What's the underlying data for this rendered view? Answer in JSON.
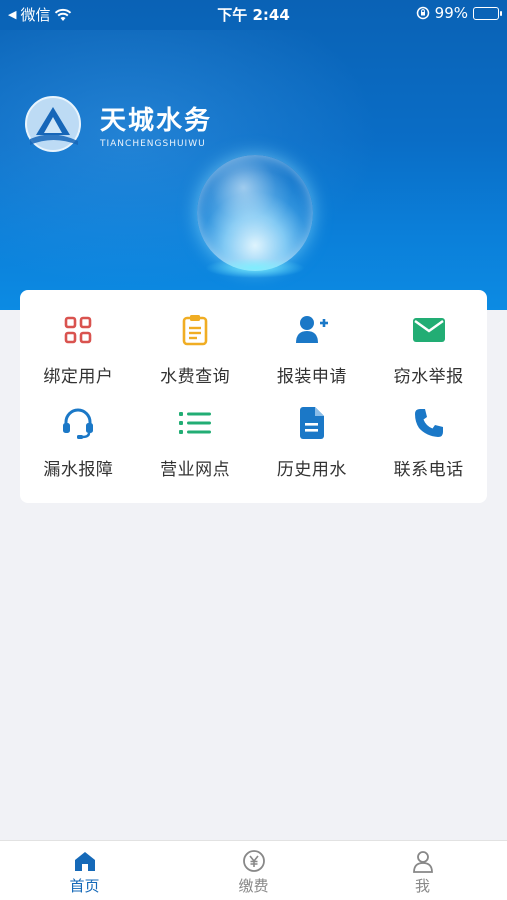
{
  "status_bar": {
    "back_app": "微信",
    "time": "下午 2:44",
    "battery": "99%",
    "battery_level": 0.99
  },
  "brand": {
    "title": "天城水务",
    "subtitle": "TIANCHENGSHUIWU"
  },
  "menu": [
    {
      "label": "绑定用户",
      "icon": "grid-icon",
      "color": "#d9534f"
    },
    {
      "label": "水费查询",
      "icon": "clipboard-icon",
      "color": "#f0ad23"
    },
    {
      "label": "报装申请",
      "icon": "add-user-icon",
      "color": "#1b78c7"
    },
    {
      "label": "窃水举报",
      "icon": "envelope-icon",
      "color": "#22ad74"
    },
    {
      "label": "漏水报障",
      "icon": "headset-icon",
      "color": "#1b78c7"
    },
    {
      "label": "营业网点",
      "icon": "list-icon",
      "color": "#22ad74"
    },
    {
      "label": "历史用水",
      "icon": "document-icon",
      "color": "#1b78c7"
    },
    {
      "label": "联系电话",
      "icon": "phone-icon",
      "color": "#1b78c7"
    }
  ],
  "tabs": [
    {
      "label": "首页",
      "icon": "home-icon",
      "active": true
    },
    {
      "label": "缴费",
      "icon": "yuan-coin-icon",
      "active": false
    },
    {
      "label": "我",
      "icon": "person-icon",
      "active": false
    }
  ],
  "colors": {
    "banner": "#0a6dc6",
    "accent": "#1569b8",
    "background": "#f1f2f6"
  }
}
